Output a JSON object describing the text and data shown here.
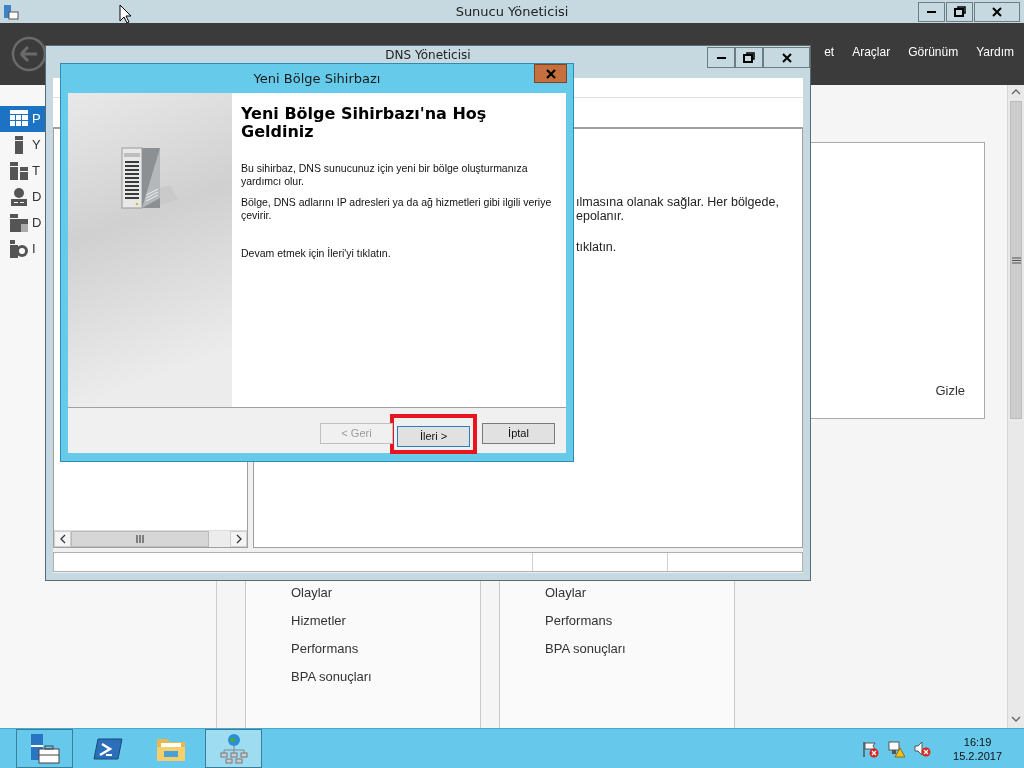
{
  "server_manager": {
    "title": "Sunucu Yöneticisi",
    "menu": [
      {
        "label": "et"
      },
      {
        "label": "Araçlar"
      },
      {
        "label": "Görünüm"
      },
      {
        "label": "Yardım"
      }
    ],
    "sidebar": [
      {
        "label": "P",
        "selected": true
      },
      {
        "label": "Y",
        "selected": false
      },
      {
        "label": "T",
        "selected": false
      },
      {
        "label": "D",
        "selected": false
      },
      {
        "label": "D",
        "selected": false
      },
      {
        "label": "I",
        "selected": false
      }
    ],
    "panel": {
      "hide_link": "Gizle"
    },
    "tiles": [
      {
        "links": [
          "Olaylar",
          "Hizmetler",
          "Performans",
          "BPA sonuçları"
        ]
      },
      {
        "links": [
          "Olaylar",
          "Performans",
          "BPA sonuçları"
        ]
      }
    ]
  },
  "dns_window": {
    "title": "DNS Yöneticisi",
    "text_lines": [
      "ılmasına olanak sağlar. Her bölgede,",
      "epolanır.",
      "tıklatın."
    ]
  },
  "wizard": {
    "title": "Yeni Bölge Sihirbazı",
    "heading": "Yeni Bölge Sihirbazı'na Hoş Geldiniz",
    "paragraphs": [
      "Bu sihirbaz, DNS sunucunuz için yeni bir bölge oluşturmanıza yardımcı olur.",
      "Bölge, DNS adlarını IP adresleri ya da ağ hizmetleri gibi ilgili veriye çevirir.",
      "Devam etmek için İleri'yi tıklatın."
    ],
    "buttons": [
      {
        "label": "< Geri",
        "disabled": true,
        "default": false,
        "highlighted": false
      },
      {
        "label": "İleri >",
        "disabled": false,
        "default": true,
        "highlighted": true
      },
      {
        "label": "İptal",
        "disabled": false,
        "default": false,
        "highlighted": false
      }
    ]
  },
  "taskbar": {
    "apps": [
      {
        "open": true,
        "selected": false
      },
      {
        "open": false,
        "selected": false
      },
      {
        "open": false,
        "selected": false
      },
      {
        "open": true,
        "selected": true
      }
    ],
    "time": "16:19",
    "date": "15.2.2017"
  }
}
